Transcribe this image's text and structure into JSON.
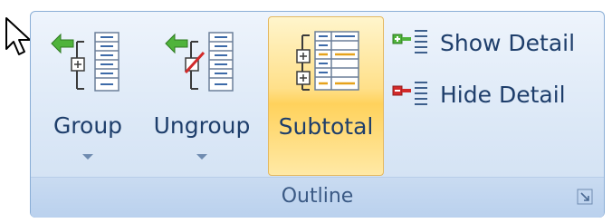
{
  "ribbon": {
    "group_label": "Outline",
    "buttons": {
      "group": "Group",
      "ungroup": "Ungroup",
      "subtotal": "Subtotal",
      "show_detail": "Show Detail",
      "hide_detail": "Hide Detail"
    },
    "icons": {
      "group": "group-icon",
      "ungroup": "ungroup-icon",
      "subtotal": "subtotal-icon",
      "show_detail": "show-detail-icon",
      "hide_detail": "hide-detail-icon",
      "launcher": "dialog-launcher-icon",
      "cursor": "mouse-pointer-icon"
    },
    "colors": {
      "accent_blue": "#8aaed6",
      "highlight": "#ffd25c",
      "text": "#1e3e6b"
    }
  }
}
